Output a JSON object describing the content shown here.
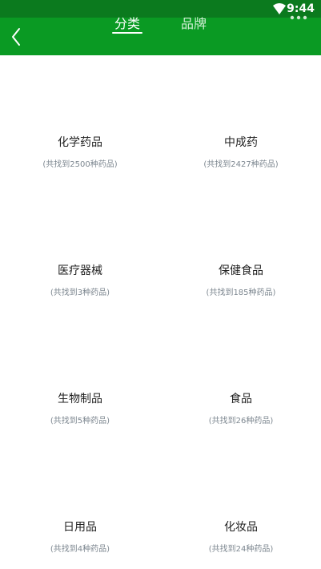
{
  "status_bar": {
    "time": "9:44"
  },
  "header": {
    "tabs": [
      {
        "label": "分类",
        "active": true
      },
      {
        "label": "品牌",
        "active": false
      }
    ]
  },
  "categories": [
    {
      "title": "化学药品",
      "count_text": "(共找到2500种药品)"
    },
    {
      "title": "中成药",
      "count_text": "(共找到2427种药品)"
    },
    {
      "title": "医疗器械",
      "count_text": "(共找到3种药品)"
    },
    {
      "title": "保健食品",
      "count_text": "(共找到185种药品)"
    },
    {
      "title": "生物制品",
      "count_text": "(共找到5种药品)"
    },
    {
      "title": "食品",
      "count_text": "(共找到26种药品)"
    },
    {
      "title": "日用品",
      "count_text": "(共找到4种药品)"
    },
    {
      "title": "化妆品",
      "count_text": "(共找到24种药品)"
    }
  ],
  "colors": {
    "brand_green": "#0a9a23",
    "status_green": "#0b7a1e"
  }
}
